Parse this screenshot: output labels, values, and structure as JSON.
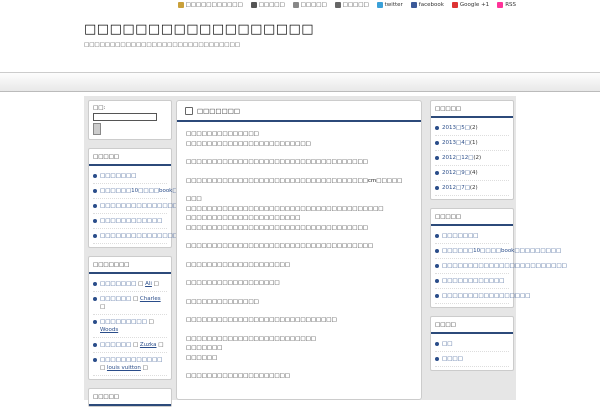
{
  "toplinks": [
    {
      "icon": "pencil-icon",
      "label": "□□□□□□□□□□□",
      "color": "#c9a03a"
    },
    {
      "icon": "user-icon",
      "label": "□□□□□",
      "color": "#555"
    },
    {
      "icon": "mail-icon",
      "label": "□□□□□",
      "color": "#888"
    },
    {
      "icon": "doc-icon",
      "label": "□□□□□",
      "color": "#666"
    },
    {
      "icon": "twitter-icon",
      "label": "twitter",
      "color": "#3aa0d8"
    },
    {
      "icon": "facebook-icon",
      "label": "facebook",
      "color": "#3b5998"
    },
    {
      "icon": "google-plus-icon",
      "label": "Google +1",
      "color": "#d33"
    },
    {
      "icon": "rss-icon",
      "label": "RSS",
      "color": "#f39"
    }
  ],
  "header": {
    "title": "□□□□□□□□□□□□□□□□□□",
    "description": "□□□□□□□□□□□□□□□□□□□□□□□□□□□□□□"
  },
  "search": {
    "label": "□□:"
  },
  "left_widgets": [
    {
      "title": "□□□□□",
      "items": [
        "□□□□□□□",
        "□□□□□□10□□□□book□□□□□□□□□",
        "□□□□□□□□□□□□□□□□□□□□□□□□",
        "□□□□□□□□□□□□",
        "□□□□□□□□□□□□□□□□□"
      ]
    },
    {
      "title": "□□□□□□□",
      "comments": [
        {
          "post": "□□□□□□□",
          "sep": "□",
          "author": "Ali",
          "tail": "□"
        },
        {
          "post": "□□□□□□",
          "sep": "□",
          "author": "Charles",
          "tail": "□"
        },
        {
          "post": "□□□□□□□□□",
          "sep": "□",
          "author": "Woods",
          "tail": ""
        },
        {
          "post": "□□□□□□",
          "sep": "□",
          "author": "Zuzka",
          "tail": "□"
        },
        {
          "post": "□□□□□□□□□□□□",
          "sep": "□",
          "author": "louis vuitton",
          "tail": "□"
        }
      ]
    },
    {
      "title": "□□□□□",
      "items": []
    }
  ],
  "post": {
    "title": "□□□□□□□",
    "paragraphs": [
      "□□□□□□□□□□□□□□\n□□□□□□□□□□□□□□□□□□□□□□□□",
      "□□□□□□□□□□□□□□□□□□□□□□□□□□□□□□□□□□□",
      "□□□□□□□□□□□□□□□□□□□□□□□□□□□□□□□□□□□cm□□□□□",
      "□□□\n□□□□□□□□□□□□□□□□□□□□□□□□□□□□□□□□□□□□□□\n□□□□□□□□□□□□□□□□□□□□□□\n□□□□□□□□□□□□□□□□□□□□□□□□□□□□□□□□□□□",
      "□□□□□□□□□□□□□□□□□□□□□□□□□□□□□□□□□□□□",
      "□□□□□□□□□□□□□□□□□□□□",
      "□□□□□□□□□□□□□□□□□□",
      "□□□□□□□□□□□□□□",
      "□□□□□□□□□□□□□□□□□□□□□□□□□□□□□",
      "□□□□□□□□□□□□□□□□□□□□□□□□□\n□□□□□□□\n□□□□□□",
      "□□□□□□□□□□□□□□□□□□□□"
    ]
  },
  "right_widgets": [
    {
      "title": "□□□□□",
      "archives": [
        {
          "label": "2013□5□",
          "count": "(2)"
        },
        {
          "label": "2013□4□",
          "count": "(1)"
        },
        {
          "label": "2012□12□",
          "count": "(2)"
        },
        {
          "label": "2012□9□",
          "count": "(4)"
        },
        {
          "label": "2012□7□",
          "count": "(2)"
        }
      ]
    },
    {
      "title": "□□□□□",
      "items": [
        "□□□□□□□",
        "□□□□□□10□□□□book□□□□□□□□□",
        "□□□□□□□□□□□□□□□□□□□□□□□□",
        "□□□□□□□□□□□□",
        "□□□□□□□□□□□□□□□□□"
      ]
    },
    {
      "title": "□□□□",
      "items": [
        "□□",
        "□□□□"
      ]
    }
  ]
}
